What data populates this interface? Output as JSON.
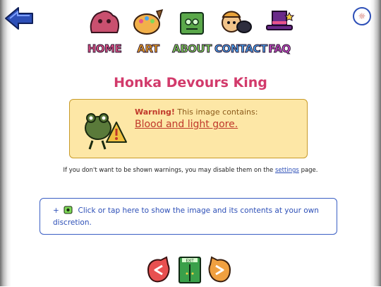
{
  "header": {
    "nav": [
      {
        "label": "HOME",
        "color": "#e8538a"
      },
      {
        "label": "ART",
        "color": "#f5a623"
      },
      {
        "label": "ABOUT",
        "color": "#7ed957"
      },
      {
        "label": "CONTACT",
        "color": "#4aa3f0"
      },
      {
        "label": "FAQ",
        "color": "#c94ac9"
      }
    ]
  },
  "page": {
    "title": "Honka Devours King"
  },
  "warning": {
    "label": "Warning!",
    "text": "This image contains:",
    "content": "Blood and light gore.",
    "bg_color": "#fde7a6",
    "border_color": "#c89b2a"
  },
  "notice": {
    "text_before": "If you don't want to be shown warnings, you may disable them on the",
    "link": "settings",
    "text_after": "page."
  },
  "reveal": {
    "plus": "+",
    "text": "Click or tap here to show the image and its contents at your own discretion."
  },
  "icons": {
    "back": "back-arrow-icon",
    "settings": "settings-badge-icon",
    "bottom": [
      "previous-icon",
      "exit-door-icon",
      "next-icon"
    ]
  }
}
